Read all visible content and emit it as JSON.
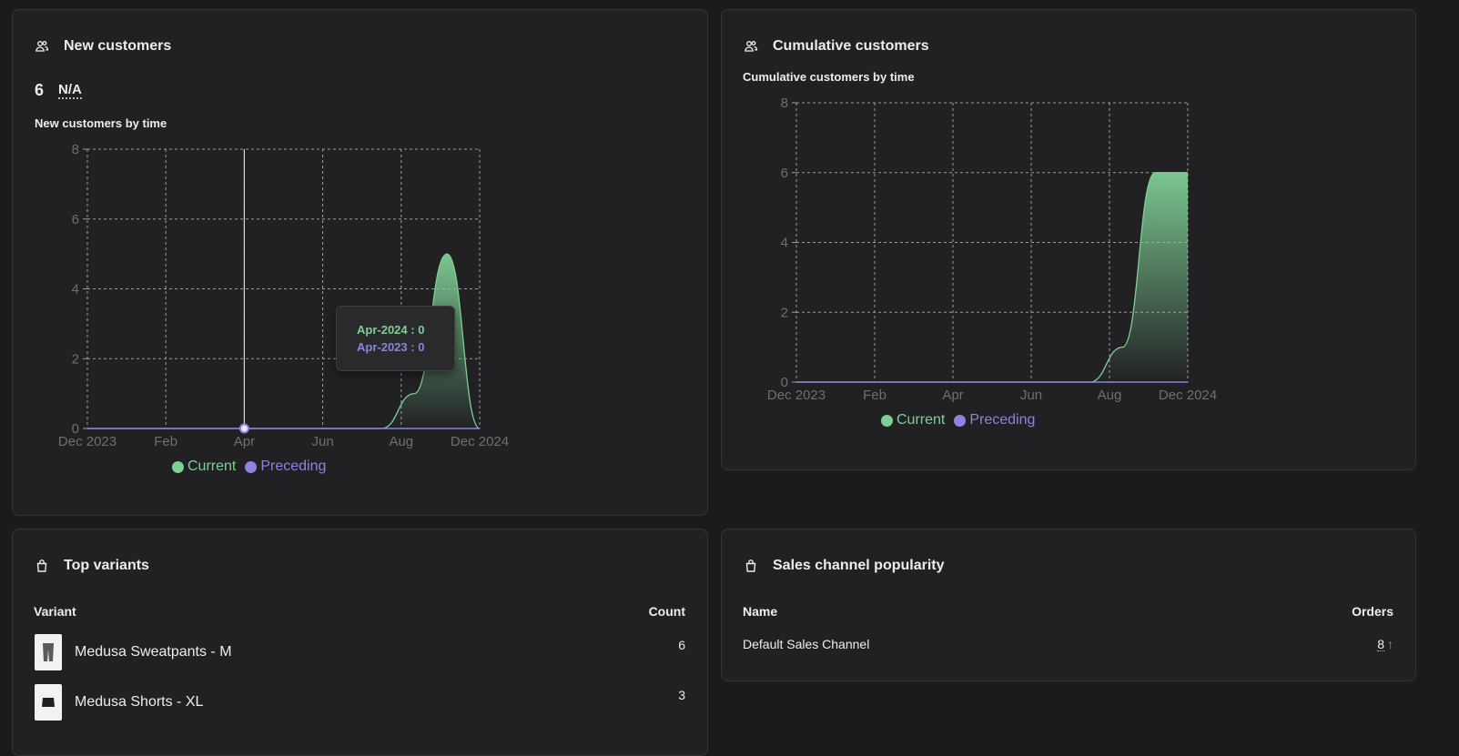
{
  "colors": {
    "current": "#7fcf95",
    "preceding": "#8b84e0",
    "grid": "#9b9ba0",
    "axis_text": "#6e6e73"
  },
  "new_customers": {
    "title": "New customers",
    "icon": "users-icon",
    "kpi_value": "6",
    "kpi_delta": "N/A",
    "chart_title": "New customers by time",
    "legend": {
      "current": "Current",
      "preceding": "Preceding"
    },
    "tooltip": {
      "current": "Apr-2024 : 0",
      "preceding": "Apr-2023 : 0"
    }
  },
  "cumulative_customers": {
    "title": "Cumulative customers",
    "icon": "users-icon",
    "chart_title": "Cumulative customers by time",
    "legend": {
      "current": "Current",
      "preceding": "Preceding"
    }
  },
  "top_variants": {
    "title": "Top variants",
    "icon": "shopping-bag-icon",
    "col_variant": "Variant",
    "col_count": "Count",
    "rows": [
      {
        "name": "Medusa Sweatpants - M",
        "count": "6",
        "thumb": "sweatpants-thumbnail"
      },
      {
        "name": "Medusa Shorts - XL",
        "count": "3",
        "thumb": "shorts-thumbnail"
      }
    ]
  },
  "sales_channel": {
    "title": "Sales channel popularity",
    "icon": "shopping-bag-icon",
    "col_name": "Name",
    "col_orders": "Orders",
    "rows": [
      {
        "name": "Default Sales Channel",
        "orders": "8",
        "trend": "↑"
      }
    ]
  },
  "chart_data": [
    {
      "type": "area",
      "x_ticks": [
        "Dec 2023",
        "Feb",
        "Apr",
        "Jun",
        "Aug",
        "Dec 2024"
      ],
      "ylim": [
        0,
        8
      ],
      "y_ticks": [
        0,
        2,
        4,
        6,
        8
      ],
      "grid": true,
      "legend_position": "bottom",
      "series": [
        {
          "name": "Current",
          "x": [
            "Dec 2023",
            "Jan",
            "Feb",
            "Mar",
            "Apr",
            "May",
            "Jun",
            "Jul",
            "Aug",
            "Sep",
            "Oct",
            "Nov",
            "Dec 2024"
          ],
          "values": [
            0,
            0,
            0,
            0,
            0,
            0,
            0,
            0,
            0,
            0,
            1,
            5,
            0
          ]
        },
        {
          "name": "Preceding",
          "x": [
            "Dec 2023",
            "Jan",
            "Feb",
            "Mar",
            "Apr",
            "May",
            "Jun",
            "Jul",
            "Aug",
            "Sep",
            "Oct",
            "Nov",
            "Dec 2024"
          ],
          "values": [
            0,
            0,
            0,
            0,
            0,
            0,
            0,
            0,
            0,
            0,
            0,
            0,
            0
          ]
        }
      ]
    },
    {
      "type": "area",
      "x_ticks": [
        "Dec 2023",
        "Feb",
        "Apr",
        "Jun",
        "Aug",
        "Dec 2024"
      ],
      "ylim": [
        0,
        8
      ],
      "y_ticks": [
        0,
        2,
        4,
        6,
        8
      ],
      "grid": true,
      "legend_position": "bottom",
      "series": [
        {
          "name": "Current",
          "x": [
            "Dec 2023",
            "Jan",
            "Feb",
            "Mar",
            "Apr",
            "May",
            "Jun",
            "Jul",
            "Aug",
            "Sep",
            "Oct",
            "Nov",
            "Dec 2024"
          ],
          "values": [
            0,
            0,
            0,
            0,
            0,
            0,
            0,
            0,
            0,
            0,
            1,
            6,
            6
          ]
        },
        {
          "name": "Preceding",
          "x": [
            "Dec 2023",
            "Jan",
            "Feb",
            "Mar",
            "Apr",
            "May",
            "Jun",
            "Jul",
            "Aug",
            "Sep",
            "Oct",
            "Nov",
            "Dec 2024"
          ],
          "values": [
            0,
            0,
            0,
            0,
            0,
            0,
            0,
            0,
            0,
            0,
            0,
            0,
            0
          ]
        }
      ]
    }
  ]
}
